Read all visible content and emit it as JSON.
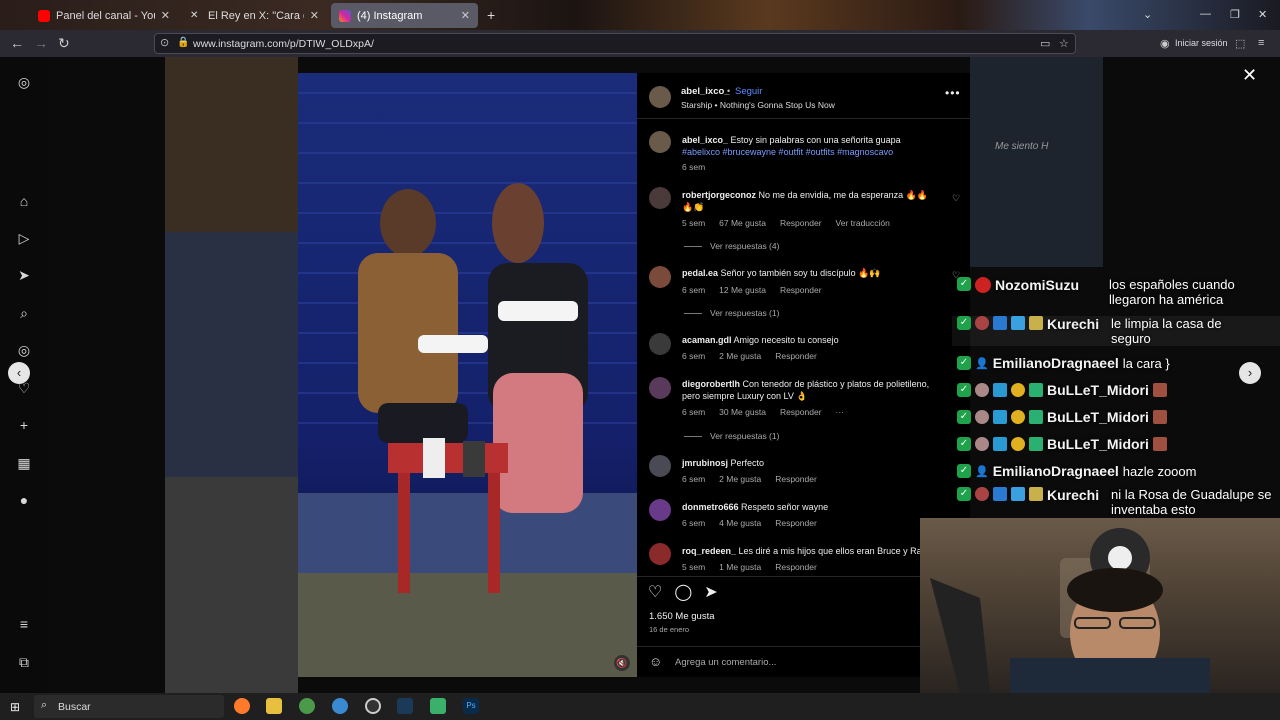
{
  "browser": {
    "tabs": [
      {
        "label": "Panel del canal - YouTube Studi",
        "color": "#ff0000"
      },
      {
        "label": "El Rey en X: \"Cara de peruano, (",
        "color": "#dddddd"
      },
      {
        "label": "(4) Instagram",
        "color": "#d6249f"
      }
    ],
    "url": "www.instagram.com/p/DTIW_OLDxpA/",
    "login_label": "Iniciar sesión"
  },
  "post": {
    "author": "abel_ixco_",
    "follow_label": "Seguir",
    "dot": "•",
    "song": "Starship • Nothing's Gonna Stop Us Now",
    "caption_user": "abel_ixco_",
    "caption_text": "Estoy sin palabras con una señorita guapa",
    "caption_tags": "#abelixco #brucewayne #outfit #outfits #magnoscavo",
    "caption_time": "6 sem",
    "likes": "1.650 Me gusta",
    "date": "16 de enero",
    "add_comment_placeholder": "Agrega un comentario..."
  },
  "comments": [
    {
      "user": "robertjorgeconoz",
      "text": "No me da envidia, me da esperanza 🔥🔥🔥👏",
      "time": "5 sem",
      "likes": "67 Me gusta",
      "reply": "Responder",
      "extra": "Ver traducción",
      "replies": "Ver respuestas (4)"
    },
    {
      "user": "pedal.ea",
      "text": "Señor yo también soy tu discípulo 🔥🙌",
      "time": "6 sem",
      "likes": "12 Me gusta",
      "reply": "Responder",
      "extra": "",
      "replies": "Ver respuestas (1)"
    },
    {
      "user": "acaman.gdl",
      "text": "Amigo necesito tu consejo",
      "time": "6 sem",
      "likes": "2 Me gusta",
      "reply": "Responder",
      "extra": "",
      "replies": ""
    },
    {
      "user": "diegorobertlh",
      "text": "Con tenedor de plástico y platos de polietileno, pero siempre Luxury con LV 👌",
      "time": "6 sem",
      "likes": "30 Me gusta",
      "reply": "Responder",
      "extra": "···",
      "replies": "Ver respuestas (1)"
    },
    {
      "user": "jmrubinosj",
      "text": "Perfecto",
      "time": "6 sem",
      "likes": "2 Me gusta",
      "reply": "Responder",
      "extra": "",
      "replies": ""
    },
    {
      "user": "donmetro666",
      "text": "Respeto señor wayne",
      "time": "6 sem",
      "likes": "4 Me gusta",
      "reply": "Responder",
      "extra": "",
      "replies": ""
    },
    {
      "user": "roq_redeen_",
      "text": "Les diré a mis hijos que ellos eran Bruce y Ra",
      "time": "5 sem",
      "likes": "1 Me gusta",
      "reply": "Responder",
      "extra": "",
      "replies": ""
    }
  ],
  "chat": [
    {
      "user": "NozomiSuzu",
      "msg": "los españoles cuando llegaron ha américa"
    },
    {
      "user": "Kurechi",
      "msg": "le limpia la casa de seguro"
    },
    {
      "user": "EmilianoDragnaeel",
      "msg": "la cara }"
    },
    {
      "user": "BuLLeT_Midori",
      "msg": ""
    },
    {
      "user": "BuLLeT_Midori",
      "msg": ""
    },
    {
      "user": "BuLLeT_Midori",
      "msg": ""
    },
    {
      "user": "EmilianoDragnaeel",
      "msg": "hazle zooom"
    },
    {
      "user": "Kurechi",
      "msg": "ni la Rosa de Guadalupe se inventaba esto"
    }
  ],
  "side_video_label": "Me siento H",
  "taskbar": {
    "search_placeholder": "Buscar"
  }
}
